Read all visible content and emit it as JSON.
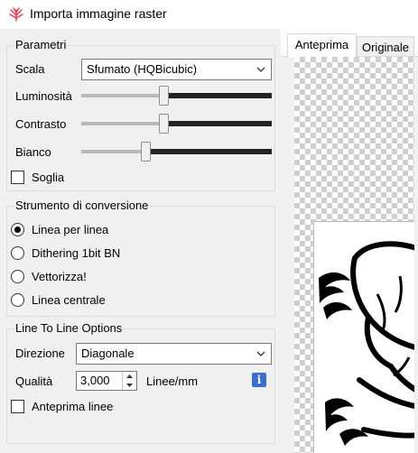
{
  "window": {
    "title": "Importa immagine raster",
    "icon": "raster-import-icon"
  },
  "parametri": {
    "group_label": "Parametri",
    "scala_label": "Scala",
    "scala_value": "Sfumato (HQBicubic)",
    "luminosita_label": "Luminosità",
    "luminosita_level": 0.43,
    "contrasto_label": "Contrasto",
    "contrasto_level": 0.43,
    "bianco_label": "Bianco",
    "bianco_level": 0.33,
    "soglia_label": "Soglia",
    "soglia_checked": false
  },
  "strumento": {
    "group_label": "Strumento di conversione",
    "options": [
      {
        "label": "Linea per linea",
        "checked": true
      },
      {
        "label": "Dithering 1bit BN",
        "checked": false
      },
      {
        "label": "Vettorizza!",
        "checked": false
      },
      {
        "label": "Linea centrale",
        "checked": false
      }
    ]
  },
  "line_options": {
    "group_label": "Line To Line Options",
    "direzione_label": "Direzione",
    "direzione_value": "Diagonale",
    "qualita_label": "Qualità",
    "qualita_value": "3,000",
    "qualita_unit": "Linee/mm",
    "info_icon": "i",
    "anteprima_linee_label": "Anteprima linee",
    "anteprima_linee_checked": false
  },
  "preview": {
    "tabs": [
      {
        "label": "Anteprima",
        "active": true
      },
      {
        "label": "Originale",
        "active": false
      }
    ]
  },
  "colors": {
    "accent": "#3a6fd1",
    "title_icon": "#e8394f",
    "slider_fill": "#222222"
  }
}
